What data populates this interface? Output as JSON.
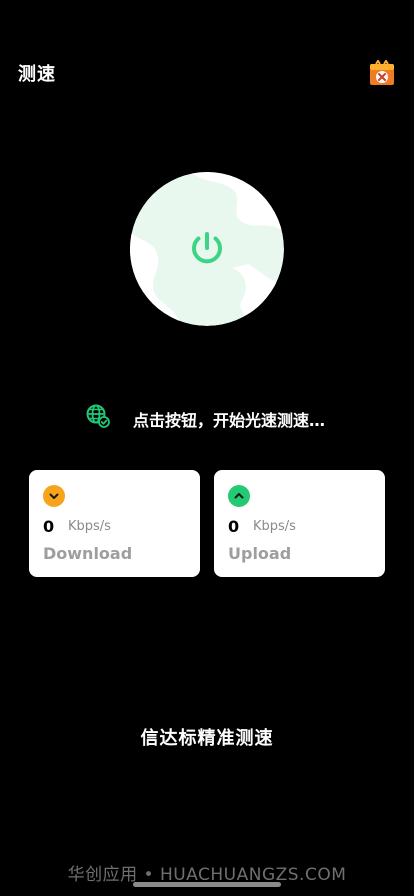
{
  "header": {
    "title": "测速",
    "shop_icon": "gift-shop-icon"
  },
  "speed_button": {
    "icon": "power-icon",
    "globe_color": "#e9f8ef",
    "land_color": "#ffffff",
    "power_color": "#3dd486"
  },
  "status": {
    "icon": "globe-check-icon",
    "text": "点击按钮，开始光速测速…",
    "icon_color": "#1fc877"
  },
  "download": {
    "icon": "chevron-down-icon",
    "icon_bg": "#f6a51a",
    "value": "0",
    "unit": "Kbps/s",
    "label": "Download"
  },
  "upload": {
    "icon": "chevron-up-icon",
    "icon_bg": "#23c973",
    "value": "0",
    "unit": "Kbps/s",
    "label": "Upload"
  },
  "footer": {
    "title": "信达标精准测速"
  },
  "watermark": "华创应用 • HUACHUANGZS.COM"
}
